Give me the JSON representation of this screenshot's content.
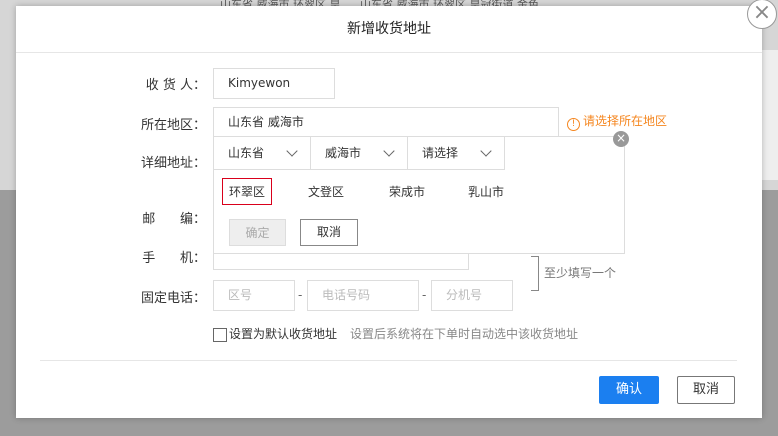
{
  "background": {
    "row1": "山东省 威海市 环翠区 皇",
    "row2": "山东省 威海市 环翠区 皇冠街道 金色"
  },
  "dialog": {
    "title": "新增收货地址",
    "close_glyph": "×"
  },
  "form": {
    "receiver_label": "收 货 人：",
    "receiver_value": "Kimyewon",
    "region_label": "所在地区：",
    "region_value": "山东省 威海市",
    "region_warning": "请选择所在地区",
    "warning_glyph": "!",
    "address_label": "详细地址：",
    "postcode_label": "邮      编：",
    "mobile_label": "手      机：",
    "phone_label": "固定电话：",
    "area_code_placeholder": "区号",
    "phone_number_placeholder": "电话号码",
    "extension_placeholder": "分机号",
    "separator": "-",
    "hint": "至少填写一个",
    "default_label": "设置为默认收货地址",
    "default_note": "设置后系统将在下单时自动选中该收货地址"
  },
  "region_picker": {
    "tabs": [
      "山东省",
      "威海市",
      "请选择"
    ],
    "options": [
      "环翠区",
      "文登区",
      "荣成市",
      "乳山市"
    ],
    "selected_option": "环翠区",
    "ok_label": "确定",
    "cancel_label": "取消",
    "close_glyph": "×"
  },
  "footer": {
    "confirm_label": "确认",
    "cancel_label": "取消"
  },
  "colors": {
    "accent": "#1b7ff0",
    "warning": "#f5861f",
    "selected_border": "#d9001b"
  }
}
